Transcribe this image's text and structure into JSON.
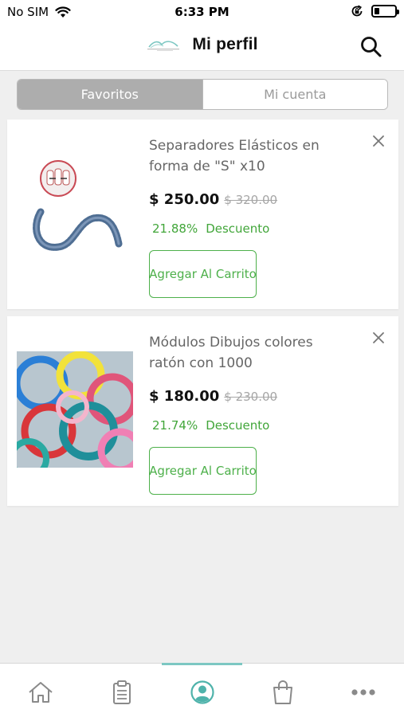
{
  "status_bar": {
    "carrier": "No SIM",
    "time": "6:33 PM",
    "battery_level": 0.25
  },
  "header": {
    "title": "Mi perfil",
    "logo_icon": "brand-logo-icon",
    "search_icon": "search-icon"
  },
  "segmented": {
    "tabs": [
      {
        "label": "Favoritos",
        "active": true
      },
      {
        "label": "Mi cuenta",
        "active": false
      }
    ]
  },
  "favorites": [
    {
      "title": "Separadores Elásticos en forma de \"S\" x10",
      "price": "$ 250.00",
      "old_price": "$ 320.00",
      "discount_percent": "21.88%",
      "discount_label": "Descuento",
      "cart_button": "Agregar Al Carrito",
      "image_icon": "elastic-separators-image"
    },
    {
      "title": "Módulos Dibujos colores ratón con 1000",
      "price": "$ 180.00",
      "old_price": "$ 230.00",
      "discount_percent": "21.74%",
      "discount_label": "Descuento",
      "cart_button": "Agregar Al Carrito",
      "image_icon": "colored-modules-image"
    }
  ],
  "tabbar": {
    "items": [
      {
        "icon": "home-icon",
        "active": false
      },
      {
        "icon": "clipboard-icon",
        "active": false
      },
      {
        "icon": "profile-icon",
        "active": true
      },
      {
        "icon": "shopping-bag-icon",
        "active": false
      },
      {
        "icon": "more-icon",
        "active": false
      }
    ]
  },
  "colors": {
    "accent_teal": "#7cc7c2",
    "discount_green": "#42a63a",
    "button_green": "#4db04a",
    "segment_active": "#adadad"
  }
}
